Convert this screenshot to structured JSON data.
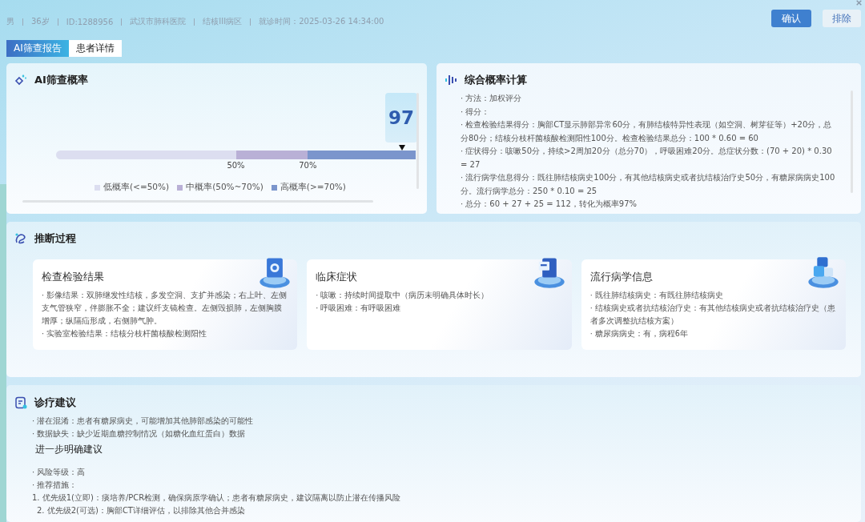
{
  "header": {
    "fields": [
      "男",
      "36岁",
      "ID:1288956",
      "武汉市肺科医院",
      "结核III病区",
      "就诊时间：2025-03-26 14:34:00"
    ]
  },
  "buttons": [
    {
      "label": "确认",
      "kind": "primary"
    },
    {
      "label": "排除",
      "kind": "secondary"
    }
  ],
  "tabs": [
    {
      "label": "AI筛查报告",
      "selected": true
    },
    {
      "label": "患者详情",
      "selected": false
    }
  ],
  "probability": {
    "title": "AI筛查概率",
    "score": "97",
    "level": 0.97,
    "segments": [
      {
        "label": "低概率(<=50%)",
        "color": "#dcdef0",
        "tick": "50%"
      },
      {
        "label": "中概率(50%~70%)",
        "color": "#b9b0d6",
        "tick": "70%"
      },
      {
        "label": "高概率(>=70%)",
        "color": "#7b95cc"
      }
    ]
  },
  "calculation": {
    "title": "综合概率计算",
    "lines": [
      "· 方法：加权评分",
      "· 得分：",
      "· 检查检验结果得分：胸部CT显示肺部异常60分，有肺结核特异性表现（如空洞、树芽征等）+20分，总分80分；结核分枝杆菌核酸检测阳性100分。检查检验结果总分：100 * 0.60 = 60",
      "· 症状得分：咳嗽50分，持续>2周加20分（总分70），呼吸困难20分。总症状分数：(70 + 20) * 0.30 = 27",
      "· 流行病学信息得分：既往肺结核病史100分，有其他结核病史或者抗结核治疗史50分，有糖尿病病史100分。流行病学总分：250 * 0.10 = 25",
      "· 总分：60 + 27 + 25 = 112，转化为概率97%"
    ]
  },
  "inference": {
    "title": "推断过程",
    "cards": [
      {
        "title": "检查检验结果",
        "kind": "camera",
        "items": [
          "· 影像结果：双肺继发性结核，多发空洞、支扩并感染；右上叶、左侧支气管狭窄，伴膨胀不全；建议纤支镜检查。左侧毁损肺，左侧胸膜增厚；纵隔疝形成，右侧肺气肿。",
          "· 实验室检验结果：结核分枝杆菌核酸检测阳性"
        ]
      },
      {
        "title": "临床症状",
        "kind": "document",
        "items": [
          "· 咳嗽：持续时间提取中（病历未明确具体时长）",
          "· 呼吸困难：有呼吸困难"
        ]
      },
      {
        "title": "流行病学信息",
        "kind": "cubes",
        "items": [
          "· 既往肺结核病史：有既往肺结核病史",
          "· 结核病史或者抗结核治疗史：有其他结核病史或者抗结核治疗史（患者多次调整抗结核方案）",
          "· 糖尿病病史：有，病程6年"
        ]
      }
    ]
  },
  "advice": {
    "title": "诊疗建议",
    "notes": [
      "· 潜在混淆：患者有糖尿病史，可能增加其他肺部感染的可能性",
      "· 数据缺失：缺少近期血糖控制情况（如糖化血红蛋白）数据"
    ],
    "subtitle": "进一步明确建议",
    "items": [
      "· 风险等级：高",
      "· 推荐措施：",
      "1. 优先级1(立即)：痰培养/PCR检测，确保病原学确认；患者有糖尿病史，建议隔离以防止潜在传播风险",
      "2. 优先级2(可选)：胸部CT详细评估，以排除其他合并感染"
    ]
  }
}
